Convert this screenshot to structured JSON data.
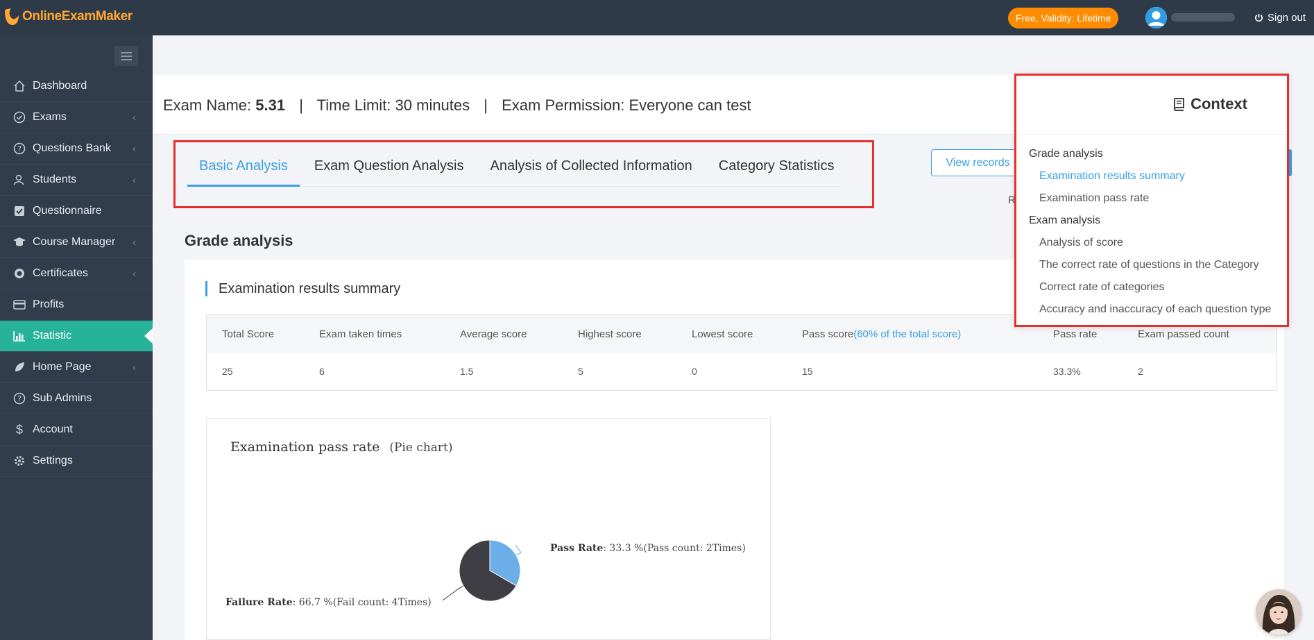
{
  "app": {
    "logo_text": "OnlineExamMaker",
    "plan_badge": "Free, Validity: Lifetime",
    "signout_label": "Sign out"
  },
  "sidebar": {
    "items": [
      {
        "label": "Dashboard",
        "icon": "home-icon",
        "has_chevron": false
      },
      {
        "label": "Exams",
        "icon": "check-circle-icon",
        "has_chevron": true
      },
      {
        "label": "Questions Bank",
        "icon": "question-icon",
        "has_chevron": true
      },
      {
        "label": "Students",
        "icon": "users-icon",
        "has_chevron": true
      },
      {
        "label": "Questionnaire",
        "icon": "checkbox-icon",
        "has_chevron": false
      },
      {
        "label": "Course Manager",
        "icon": "graduation-cap-icon",
        "has_chevron": true
      },
      {
        "label": "Certificates",
        "icon": "certificate-icon",
        "has_chevron": true
      },
      {
        "label": "Profits",
        "icon": "credit-card-icon",
        "has_chevron": false
      },
      {
        "label": "Statistic",
        "icon": "bar-chart-icon",
        "has_chevron": false,
        "active": true
      },
      {
        "label": "Home Page",
        "icon": "leaf-icon",
        "has_chevron": true
      },
      {
        "label": "Sub Admins",
        "icon": "question-icon",
        "has_chevron": false
      },
      {
        "label": "Account",
        "icon": "dollar-icon",
        "has_chevron": false
      },
      {
        "label": "Settings",
        "icon": "gear-icon",
        "has_chevron": false
      }
    ]
  },
  "exam": {
    "name_label": "Exam Name:",
    "name_value": "5.31",
    "time_limit": "Time Limit: 30 minutes",
    "permission": "Exam Permission: Everyone can test",
    "separator": "|"
  },
  "tabs": [
    "Basic Analysis",
    "Exam Question Analysis",
    "Analysis of Collected Information",
    "Category Statistics"
  ],
  "toolbar": {
    "view_records": "View records",
    "partial_glyph": "R"
  },
  "grade": {
    "title": "Grade analysis",
    "summary_title": "Examination results summary",
    "headers": [
      "Total Score",
      "Exam taken times",
      "Average score",
      "Highest score",
      "Lowest score",
      "Pass score",
      "Pass rate",
      "Exam passed count"
    ],
    "pass_score_note": "(60% of the total score)",
    "values": [
      "25",
      "6",
      "1.5",
      "5",
      "0",
      "15",
      "33.3%",
      "2"
    ]
  },
  "pie": {
    "title": "Examination pass rate",
    "subtitle": "(Pie chart)",
    "pass_label": "Pass Rate",
    "pass_text": ": 33.3 %(Pass count: 2Times)",
    "fail_label": "Failure Rate",
    "fail_text": ": 66.7 %(Fail count: 4Times)",
    "colors": {
      "pass": "#6baee8",
      "fail": "#3e3e44"
    }
  },
  "chart_data": {
    "type": "pie",
    "title": "Examination pass rate",
    "subtitle": "(Pie chart)",
    "slices": [
      {
        "name": "Pass Rate",
        "value": 33.3,
        "count": 2
      },
      {
        "name": "Failure Rate",
        "value": 66.7,
        "count": 4
      }
    ]
  },
  "context": {
    "title": "Context",
    "items": [
      {
        "label": "Grade analysis",
        "level": 0
      },
      {
        "label": "Examination results summary",
        "level": 1,
        "current": true
      },
      {
        "label": "Examination pass rate",
        "level": 1
      },
      {
        "label": "Exam analysis",
        "level": 0
      },
      {
        "label": "Analysis of score",
        "level": 1
      },
      {
        "label": "The correct rate of questions in the Category",
        "level": 1
      },
      {
        "label": "Correct rate of categories",
        "level": 1
      },
      {
        "label": "Accuracy and inaccuracy of each question type",
        "level": 1
      }
    ]
  }
}
